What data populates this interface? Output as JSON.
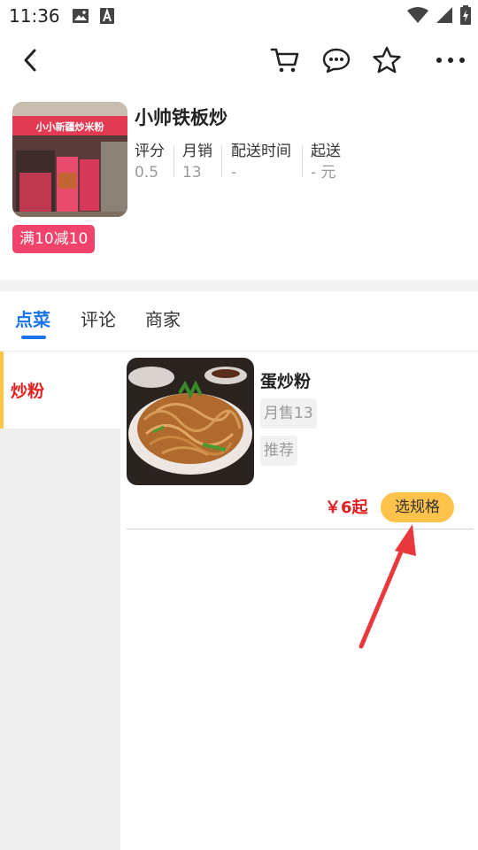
{
  "status_bar": {
    "time": "11:36",
    "left_icons": [
      "image-icon",
      "text-a-icon"
    ],
    "right_icons": [
      "wifi-icon",
      "signal-icon",
      "battery-icon"
    ]
  },
  "top_nav": {
    "back_icon": "chevron-left-icon",
    "actions": [
      "cart-icon",
      "message-icon",
      "star-icon",
      "more-icon"
    ]
  },
  "shop": {
    "name": "小帅铁板炒",
    "photo_sign_text": "小小新疆炒米粉",
    "stats": [
      {
        "label": "评分",
        "value": "0.5"
      },
      {
        "label": "月销",
        "value": "13"
      },
      {
        "label": "配送时间",
        "value": "-"
      },
      {
        "label": "起送",
        "value": "- 元"
      }
    ],
    "promo": "满10减10"
  },
  "tabs": [
    {
      "label": "点菜",
      "active": true
    },
    {
      "label": "评论",
      "active": false
    },
    {
      "label": "商家",
      "active": false
    }
  ],
  "sidebar": {
    "items": [
      {
        "label": "炒粉",
        "active": true
      }
    ]
  },
  "menu": {
    "items": [
      {
        "name": "蛋炒粉",
        "monthly_sales": "月售13",
        "tag": "推荐",
        "price": "￥6起",
        "select_button": "选规格"
      }
    ]
  },
  "colors": {
    "accent_blue": "#1a73e8",
    "price_red": "#e02020",
    "promo_pink": "#f0436b",
    "button_yellow": "#ffc24a",
    "annotation_arrow": "#e8393f"
  }
}
